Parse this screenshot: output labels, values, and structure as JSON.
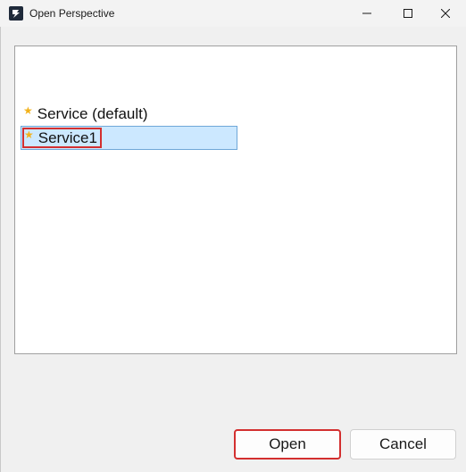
{
  "window": {
    "title": "Open Perspective",
    "app_icon": "app-logo-icon",
    "controls": [
      "minimize-icon",
      "maximize-icon",
      "close-icon"
    ]
  },
  "perspectives": [
    {
      "label": "Service (default)",
      "icon": "star-icon",
      "selected": false
    },
    {
      "label": "Service1",
      "icon": "star-icon",
      "selected": true
    }
  ],
  "buttons": {
    "open": "Open",
    "cancel": "Cancel"
  },
  "colors": {
    "selection_bg": "#cce8ff",
    "selection_border": "#6fa7d8",
    "highlight_red": "#d32f2f",
    "star": "#f2b21b"
  }
}
